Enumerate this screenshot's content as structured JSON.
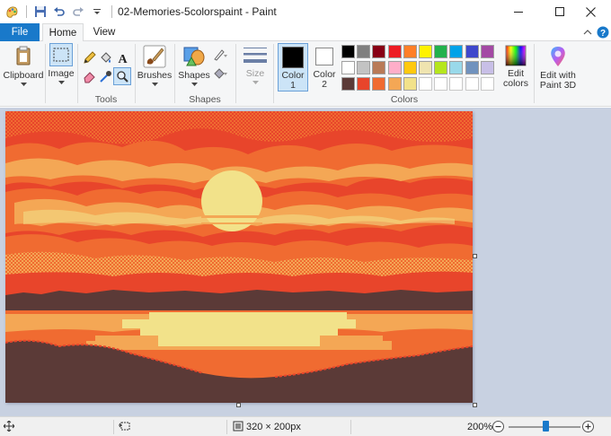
{
  "window": {
    "title": "02-Memories-5colorspaint - Paint"
  },
  "ribbon_tabs": {
    "file": "File",
    "home": "Home",
    "view": "View"
  },
  "groups": {
    "clipboard": {
      "label": "Clipboard"
    },
    "image": {
      "label": "Image"
    },
    "tools": {
      "label": "Tools"
    },
    "brushes": {
      "label": "Brushes"
    },
    "shapes": {
      "label": "Shapes",
      "button": "Shapes"
    },
    "size": {
      "label": "Size"
    },
    "colors": {
      "label": "Colors",
      "color1": "Color",
      "color1_num": "1",
      "color2": "Color",
      "color2_num": "2",
      "edit_colors": "Edit",
      "edit_colors2": "colors",
      "edit_paint3d": "Edit with",
      "edit_paint3d2": "Paint 3D"
    }
  },
  "palette": {
    "color1": "#000000",
    "color2": "#ffffff",
    "row1": [
      "#000000",
      "#7f7f7f",
      "#880015",
      "#ed1c24",
      "#ff7f27",
      "#fff200",
      "#22b14c",
      "#00a2e8",
      "#3f48cc",
      "#a349a4"
    ],
    "row2": [
      "#ffffff",
      "#c3c3c3",
      "#b97a57",
      "#ffaec9",
      "#ffc90e",
      "#efe4b0",
      "#b5e61d",
      "#99d9ea",
      "#7092be",
      "#c8bfe7"
    ],
    "row3": [
      "#5b3a37",
      "#e8452b",
      "#f06b31",
      "#f4a755",
      "#f2e28a",
      "",
      "",
      "",
      "",
      ""
    ]
  },
  "status": {
    "image_size": "320 × 200px",
    "zoom": "200%"
  }
}
